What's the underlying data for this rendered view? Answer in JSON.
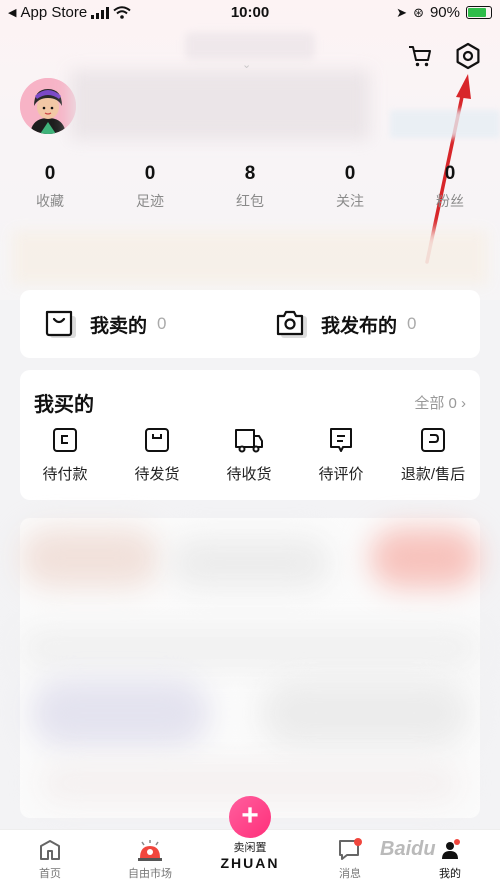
{
  "status_bar": {
    "back_app": "App Store",
    "time": "10:00",
    "battery": "90%"
  },
  "stats": [
    {
      "value": "0",
      "label": "收藏"
    },
    {
      "value": "0",
      "label": "足迹"
    },
    {
      "value": "8",
      "label": "红包"
    },
    {
      "value": "0",
      "label": "关注"
    },
    {
      "value": "0",
      "label": "粉丝"
    }
  ],
  "sell_card": {
    "my_sold": {
      "label": "我卖的",
      "count": "0"
    },
    "my_published": {
      "label": "我发布的",
      "count": "0"
    }
  },
  "buy_card": {
    "title": "我买的",
    "all_label": "全部 0 ›",
    "orders": [
      {
        "label": "待付款",
        "icon": "pending-payment-icon"
      },
      {
        "label": "待发货",
        "icon": "pending-shipment-icon"
      },
      {
        "label": "待收货",
        "icon": "pending-receipt-icon"
      },
      {
        "label": "待评价",
        "icon": "pending-review-icon"
      },
      {
        "label": "退款/售后",
        "icon": "refund-icon"
      }
    ]
  },
  "tab_bar": {
    "home": "首页",
    "market": "自由市场",
    "sell": "卖闲置",
    "brand": "ZHUAN",
    "messages": "消息",
    "mine": "我的"
  },
  "watermark": "Baidu",
  "colors": {
    "accent_pink": "#ff2f7a",
    "annotation_red": "#d8262a",
    "battery_green": "#2fbd4a"
  }
}
